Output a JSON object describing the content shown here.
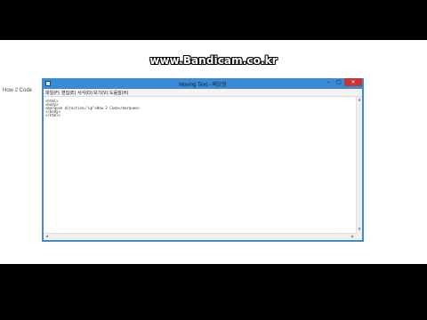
{
  "watermark": "www.Bandicam.co.kr",
  "side_label": "How 2 Code",
  "window": {
    "title": "Moving Text - 메모장",
    "controls": {
      "minimize": "–",
      "maximize": "□",
      "close": "✕"
    }
  },
  "menu": [
    "파일(F)",
    "편집(E)",
    "서식(O)",
    "보기(V)",
    "도움말(H)"
  ],
  "editor": {
    "lines": [
      "<html>",
      "<body>",
      "<marquee direction=\"up\">How 2 Code</marquee>",
      "</body>",
      "</html>"
    ]
  },
  "scroll": {
    "up": "▲",
    "down": "▼",
    "left": "◀",
    "right": "▶"
  },
  "colors": {
    "frame": "#3b8ad6",
    "close": "#c7372f"
  }
}
